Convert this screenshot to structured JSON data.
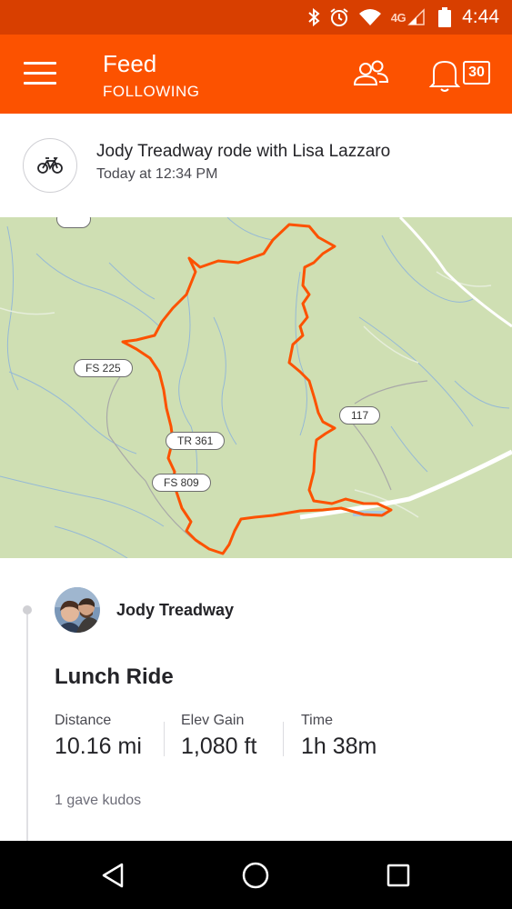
{
  "status_bar": {
    "network": "4G",
    "time": "4:44",
    "icons": [
      "bluetooth-icon",
      "alarm-icon",
      "wifi-icon",
      "signal-icon",
      "battery-icon"
    ]
  },
  "app_bar": {
    "title": "Feed",
    "subtitle": "FOLLOWING",
    "notification_count": "30",
    "color": "#fc5200"
  },
  "feed_item": {
    "headline": "Jody Treadway rode with Lisa Lazzaro",
    "timestamp": "Today at 12:34 PM",
    "sport_icon": "bike-icon",
    "map": {
      "route_color": "#fc5200",
      "road_labels": [
        "FS 225",
        "TR 361",
        "FS 809",
        "117"
      ]
    },
    "athlete": "Jody Treadway",
    "activity_title": "Lunch Ride",
    "stats": [
      {
        "label": "Distance",
        "value": "10.16 mi"
      },
      {
        "label": "Elev Gain",
        "value": "1,080 ft"
      },
      {
        "label": "Time",
        "value": "1h 38m"
      }
    ],
    "kudos_text": "1 gave kudos"
  },
  "nav_bar": {
    "buttons": [
      "back-icon",
      "home-icon",
      "recents-icon"
    ]
  }
}
